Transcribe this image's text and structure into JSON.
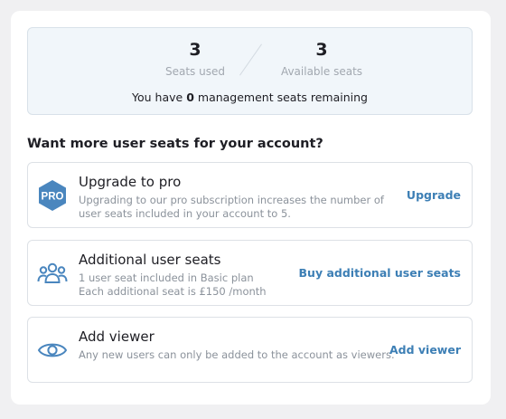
{
  "stats": {
    "seats_used_value": "3",
    "seats_used_label": "Seats used",
    "available_seats_value": "3",
    "available_seats_label": "Available seats",
    "remaining_prefix": "You have",
    "remaining_count": "0",
    "remaining_suffix": "management seats remaining"
  },
  "section_title": "Want more user seats for your account?",
  "options": [
    {
      "title": "Upgrade to pro",
      "description": "Upgrading to our pro subscription increases the number of user seats included in your account to 5.",
      "action": "Upgrade",
      "icon": "pro-badge-icon",
      "icon_text": "PRO"
    },
    {
      "title": "Additional user seats",
      "description_line1": "1 user seat included in Basic plan",
      "description_line2": "Each additional seat is £150 /month",
      "action": "Buy additional user seats",
      "icon": "users-group-icon"
    },
    {
      "title": "Add viewer",
      "description": "Any new users can only be added to the account as viewers.",
      "action": "Add viewer",
      "icon": "eye-icon"
    }
  ],
  "colors": {
    "accent": "#3d7fb5",
    "stats_bg": "#f1f6fa",
    "page_bg": "#f0f0f2"
  }
}
